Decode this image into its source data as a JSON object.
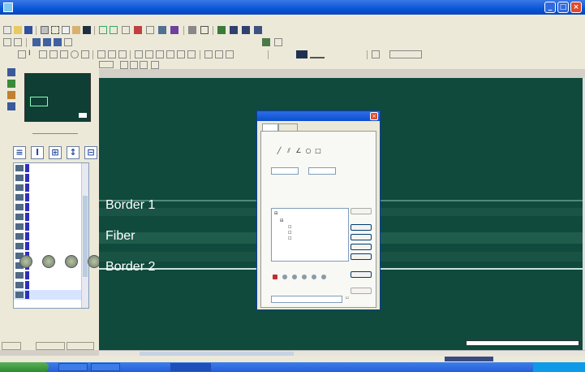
{
  "canvas": {
    "background": "#0f4a3c",
    "labels": {
      "border1": "Border 1",
      "fiber": "Fiber",
      "border2": "Border 2"
    },
    "scalebar_text": ""
  },
  "dialog": {
    "tabs": [],
    "buttons": []
  },
  "layers": []
}
